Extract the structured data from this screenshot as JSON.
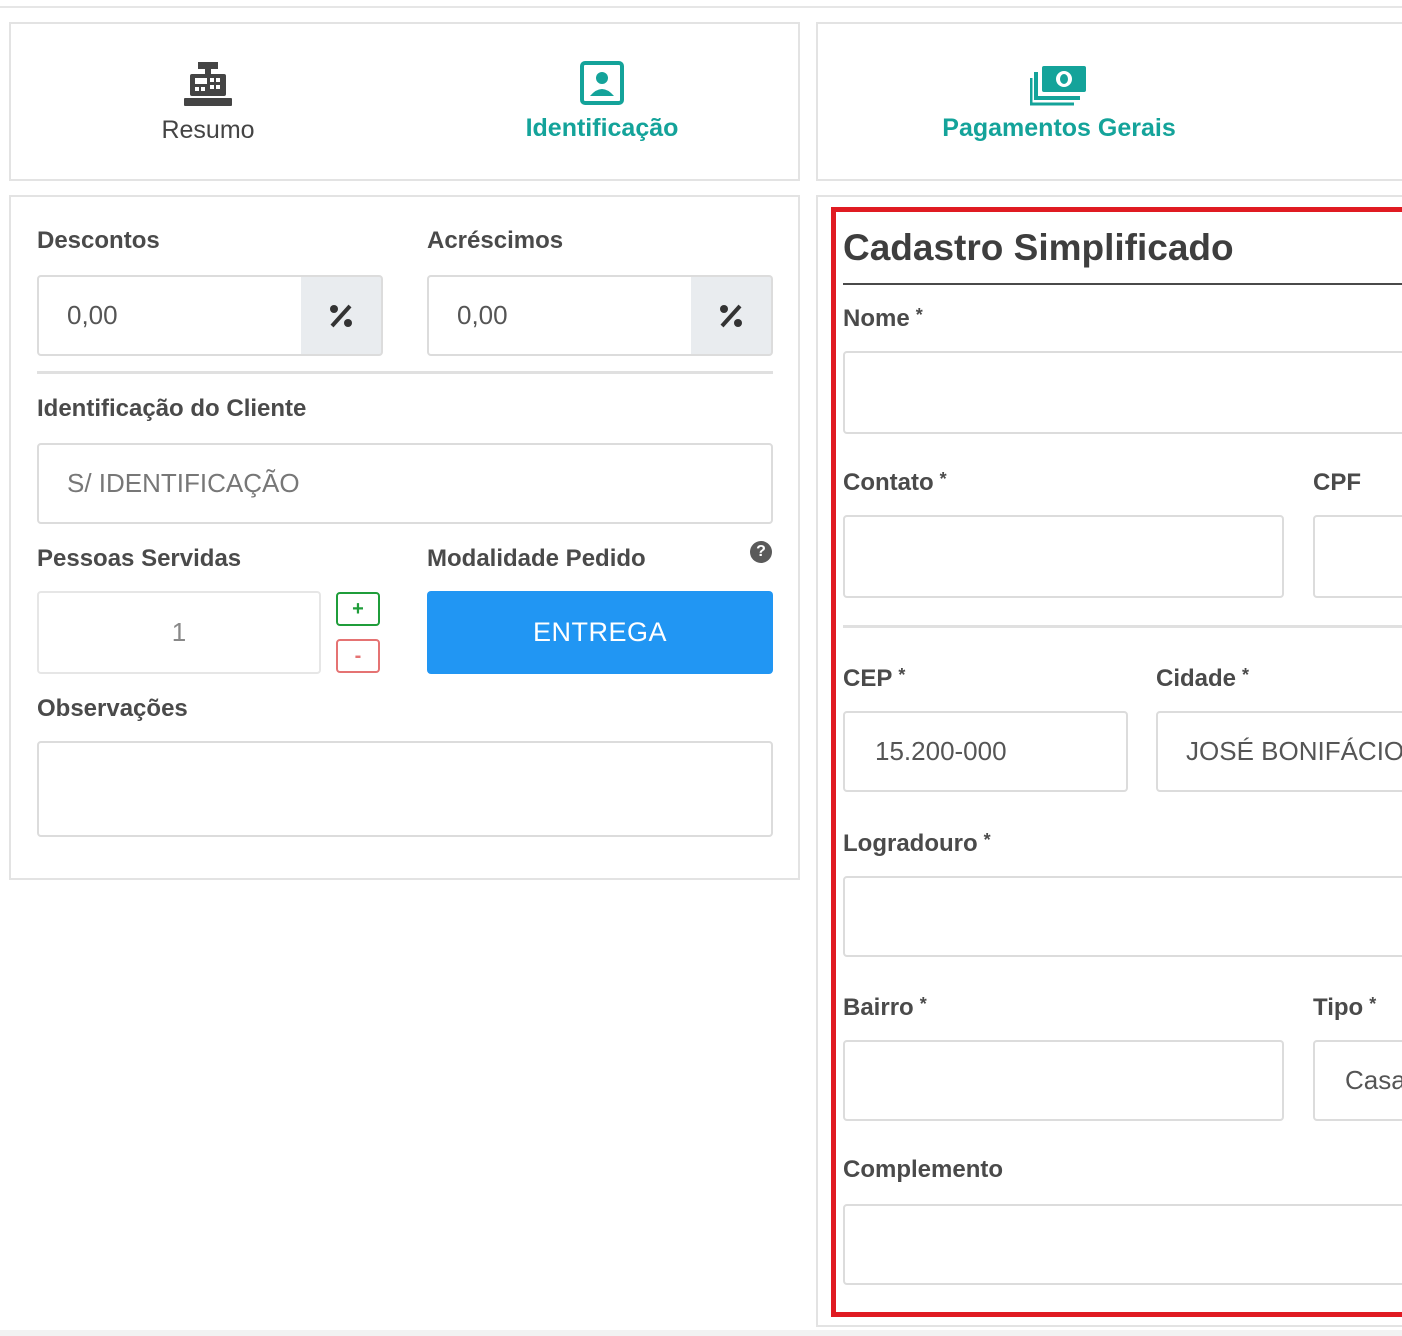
{
  "tabs": {
    "resumo": "Resumo",
    "identificacao": "Identificação",
    "pagamentos": "Pagamentos Gerais"
  },
  "left": {
    "descontos_label": "Descontos",
    "descontos_value": "0,00",
    "acrescimos_label": "Acréscimos",
    "acrescimos_value": "0,00",
    "percent_symbol": "%",
    "cliente_label": "Identificação do Cliente",
    "cliente_placeholder": "S/ IDENTIFICAÇÃO",
    "pessoas_label": "Pessoas Servidas",
    "pessoas_value": "1",
    "plus": "+",
    "minus": "-",
    "modalidade_label": "Modalidade Pedido",
    "modalidade_value": "ENTREGA",
    "help": "?",
    "observacoes_label": "Observações"
  },
  "cadastro": {
    "title": "Cadastro Simplificado",
    "required_mark": "*",
    "nome_label": "Nome",
    "contato_label": "Contato",
    "cpf_label": "CPF",
    "cep_label": "CEP",
    "cep_value": "15.200-000",
    "cidade_label": "Cidade",
    "cidade_value": "JOSÉ BONIFÁCIO -",
    "logradouro_label": "Logradouro",
    "bairro_label": "Bairro",
    "tipo_label": "Tipo",
    "tipo_value": "Casa",
    "complemento_label": "Complemento"
  },
  "colors": {
    "accent": "#14a39a",
    "button_blue": "#2196f3",
    "highlight_red": "#e01b22"
  }
}
